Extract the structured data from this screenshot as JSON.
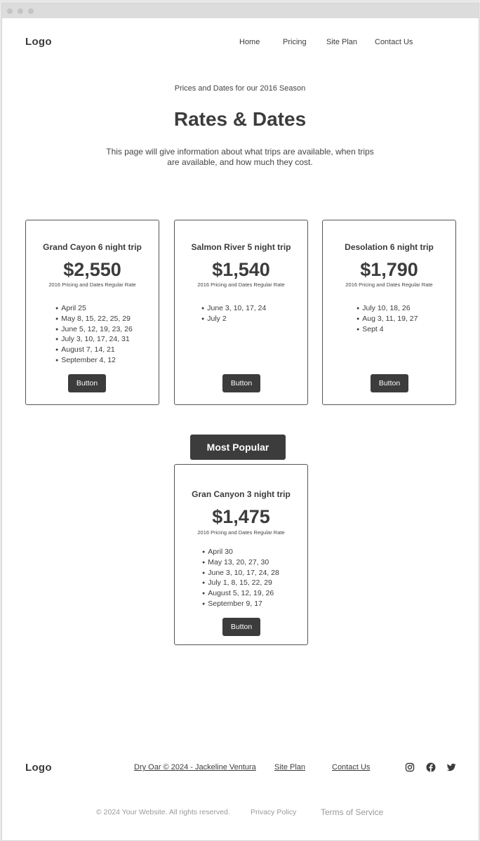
{
  "header": {
    "logo": "Logo",
    "nav": [
      "Home",
      "Pricing",
      "Site Plan",
      "Contact Us"
    ]
  },
  "hero": {
    "kicker": "Prices and Dates for our 2016 Season",
    "title": "Rates & Dates",
    "description": "This page will give information about what trips are available, when trips are available, and how much they cost."
  },
  "cards": [
    {
      "title": "Grand Cayon 6 night trip",
      "price": "$2,550",
      "subtitle": "2016 Pricing and Dates Regular Rate",
      "dates": [
        "April 25",
        "May 8, 15, 22, 25, 29",
        "June 5, 12, 19, 23, 26",
        "July 3, 10, 17, 24, 31",
        "August 7, 14, 21",
        "September 4, 12"
      ],
      "button": "Button"
    },
    {
      "title": "Salmon River 5 night trip",
      "price": "$1,540",
      "subtitle": "2016 Pricing and Dates Regular Rate",
      "dates": [
        "June 3, 10, 17, 24",
        "July 2"
      ],
      "button": "Button"
    },
    {
      "title": "Desolation 6 night trip",
      "price": "$1,790",
      "subtitle": "2016 Pricing and Dates Regular Rate",
      "dates": [
        "July 10, 18, 26",
        "Aug 3, 11, 19, 27",
        "Sept 4"
      ],
      "button": "Button"
    },
    {
      "title": "Gran Canyon 3 night trip",
      "price": "$1,475",
      "subtitle": "2016 Pricing and Dates Regular Rate",
      "dates": [
        "April 30",
        "May 13, 20, 27, 30",
        "June 3, 10, 17, 24, 28",
        "July 1, 8, 15, 22, 29",
        "August 5, 12, 19, 26",
        "September 9, 17"
      ],
      "button": "Button"
    }
  ],
  "popular_label": "Most Popular",
  "footer": {
    "logo": "Logo",
    "credit": "Dry Oar © 2024 - Jackeline Ventura",
    "site_plan": "Site Plan",
    "contact": "Contact Us",
    "social_icons": [
      "instagram-icon",
      "facebook-icon",
      "twitter-icon"
    ],
    "copyright": "© 2024 Your Website. All rights reserved.",
    "privacy": "Privacy Policy",
    "terms": "Terms of Service"
  },
  "colors": {
    "primary_dark": "#3c3c3c",
    "muted_text": "#9a9a9a",
    "titlebar": "#dcdcdc"
  }
}
